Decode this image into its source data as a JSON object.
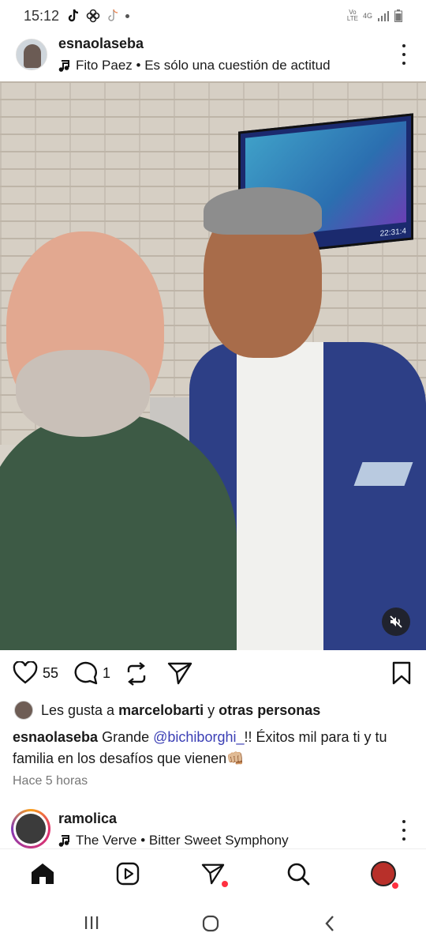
{
  "status_bar": {
    "time": "15:12",
    "left_icons": [
      "tiktok-icon",
      "pinwheel-icon",
      "tiktok-outline-icon"
    ],
    "network_label_top": "Vo",
    "network_label_bottom": "LTE",
    "network_type": "4G"
  },
  "post": {
    "username": "esnaolaseba",
    "song": "Fito Paez • Es sólo una cuestión de actitud",
    "like_count": "55",
    "comment_count": "1",
    "likes_prefix": "Les gusta a",
    "likes_user": "marcelobarti",
    "likes_joiner": "y",
    "likes_others": "otras personas",
    "caption_user": "esnaolaseba",
    "caption_pre": "Grande",
    "caption_mention": "@bichiborghi_",
    "caption_post": "!! Éxitos mil para ti y tu familia en los desafíos que vienen👊🏼",
    "timestamp": "Hace 5 horas",
    "tv_clock": "22:31:4"
  },
  "next_post": {
    "username": "ramolica",
    "song": "The Verve • Bitter Sweet Symphony"
  },
  "colors": {
    "mention": "#3b3fb5",
    "notification_dot": "#ff3040",
    "story_ring": [
      "#f9a11b",
      "#e1306c",
      "#c13584",
      "#833ab4"
    ]
  }
}
